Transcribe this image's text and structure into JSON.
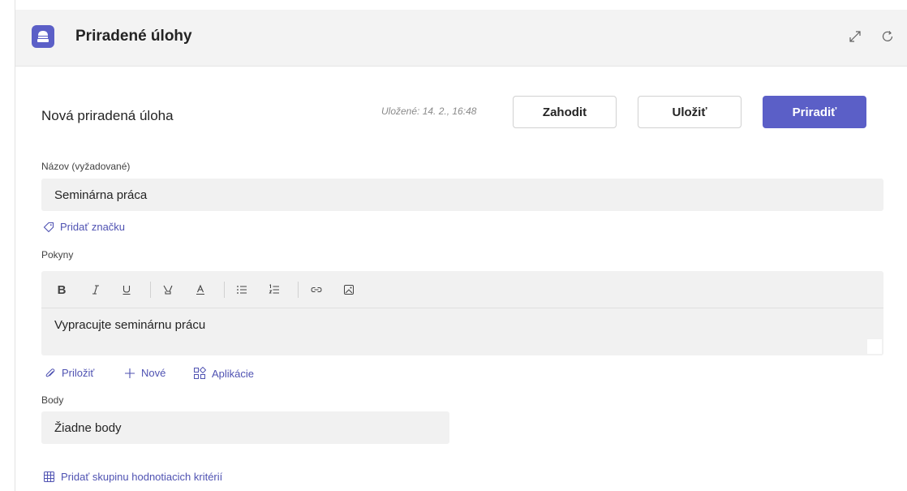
{
  "app": {
    "title": "Priradené úlohy"
  },
  "form": {
    "title": "Nová priradená úloha",
    "saved_status": "Uložené: 14. 2., 16:48",
    "buttons": {
      "discard": "Zahodit",
      "save": "Uložiť",
      "assign": "Priradiť"
    },
    "name_label": "Názov (vyžadované)",
    "name_value": "Seminárna práca",
    "add_tag": "Pridať značku",
    "instructions_label": "Pokyny",
    "instructions_value": "Vypracujte seminárnu prácu",
    "attach": {
      "attach": "Priložiť",
      "new": "Nové",
      "apps": "Aplikácie"
    },
    "points_label": "Body",
    "points_value": "Žiadne body",
    "add_rubric": "Pridať skupinu hodnotiacich kritérií"
  },
  "toolbar_icons": [
    "bold-icon",
    "italic-icon",
    "underline-icon",
    "highlight-icon",
    "font-color-icon",
    "bullet-list-icon",
    "numbered-list-icon",
    "link-icon",
    "image-icon"
  ],
  "colors": {
    "accent": "#5b5fc7",
    "link": "#4f52b2",
    "field_bg": "#f1f1f1"
  }
}
